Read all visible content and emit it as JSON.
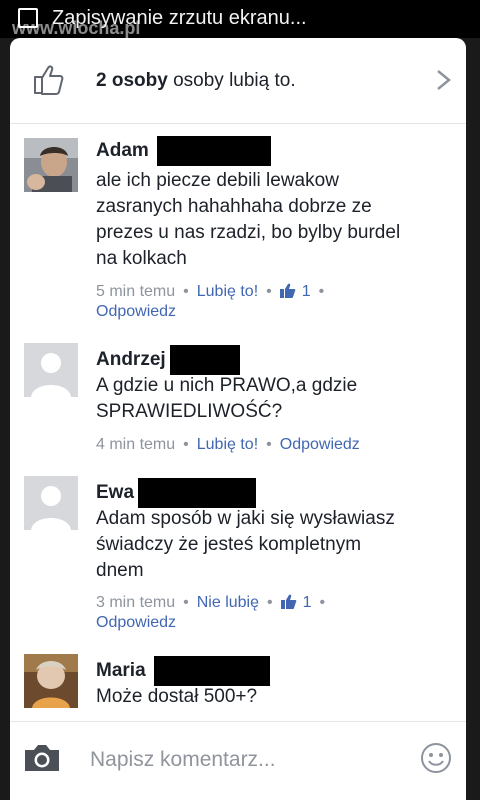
{
  "status_bar": {
    "notification": "Zapisywanie zrzutu ekranu...",
    "watermark": "www.wiocha.pl"
  },
  "likes": {
    "count_label": "2 osoby",
    "suffix": "osoby lubią to."
  },
  "comments": [
    {
      "name": "Adam",
      "text_lines": [
        "ale ich piecze debili lewakow",
        "zasranych hahahhaha dobrze ze",
        "prezes u nas rzadzi, bo bylby burdel",
        "na kolkach"
      ],
      "time": "5 min temu",
      "like_action": "Lubię to!",
      "like_count": "1",
      "reply": "Odpowiedz"
    },
    {
      "name": "Andrzej",
      "text_lines": [
        "A gdzie u nich PRAWO,a gdzie",
        "SPRAWIEDLIWOŚĆ?"
      ],
      "time": "4 min temu",
      "like_action": "Lubię to!",
      "reply": "Odpowiedz"
    },
    {
      "name": "Ewa",
      "text_lines": [
        "Adam sposób w jaki się wysławiasz",
        "świadczy że jesteś kompletnym",
        "dnem"
      ],
      "time": "3 min temu",
      "like_action": "Nie lubię",
      "like_count": "1",
      "reply": "Odpowiedz"
    },
    {
      "name": "Maria",
      "text_lines": [
        "Może dostał 500+?"
      ]
    }
  ],
  "composer": {
    "placeholder": "Napisz komentarz..."
  },
  "colors": {
    "link": "#4267b2",
    "text": "#1d2129",
    "meta": "#8d949e"
  }
}
